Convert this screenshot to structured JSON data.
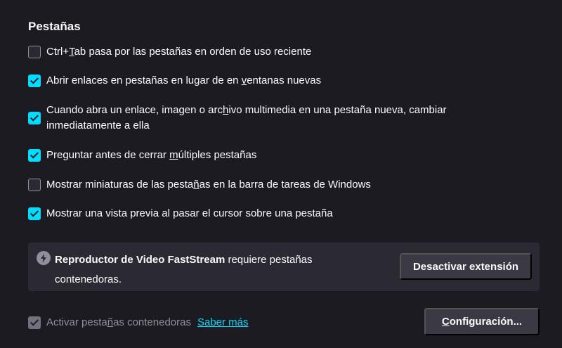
{
  "section": {
    "title": "Pestañas"
  },
  "options": [
    {
      "label": "Ctrl+Tab pasa por las pestañas en orden de uso reciente",
      "checked": false
    },
    {
      "label": "Abrir enlaces en pestañas en lugar de en ventanas nuevas",
      "checked": true
    },
    {
      "label": "Cuando abra un enlace, imagen o archivo multimedia en una pestaña nueva, cambiar",
      "label_line2": "inmediatamente a ella",
      "checked": true
    },
    {
      "label": "Preguntar antes de cerrar múltiples pestañas",
      "checked": true
    },
    {
      "label": "Mostrar miniaturas de las pestañas en la barra de tareas de Windows",
      "checked": false
    },
    {
      "label": "Mostrar una vista previa al pasar el cursor sobre una pestaña",
      "checked": true
    }
  ],
  "notice": {
    "icon": "lightning-bolt-icon",
    "extension_name": "Reproductor de Video FastStream",
    "text_rest": " requiere pestañas",
    "text_line2": "contenedoras.",
    "button_label": "Desactivar extensión"
  },
  "containers": {
    "label": "Activar pestañas contenedoras",
    "checked": true,
    "disabled": true,
    "learn_more": "Saber más",
    "settings_button": "Configuración..."
  },
  "colors": {
    "background": "#1c1b22",
    "accent": "#00ddff",
    "panel": "#2b2a33",
    "button": "#3a3944",
    "muted_text": "#8f8f9d"
  }
}
